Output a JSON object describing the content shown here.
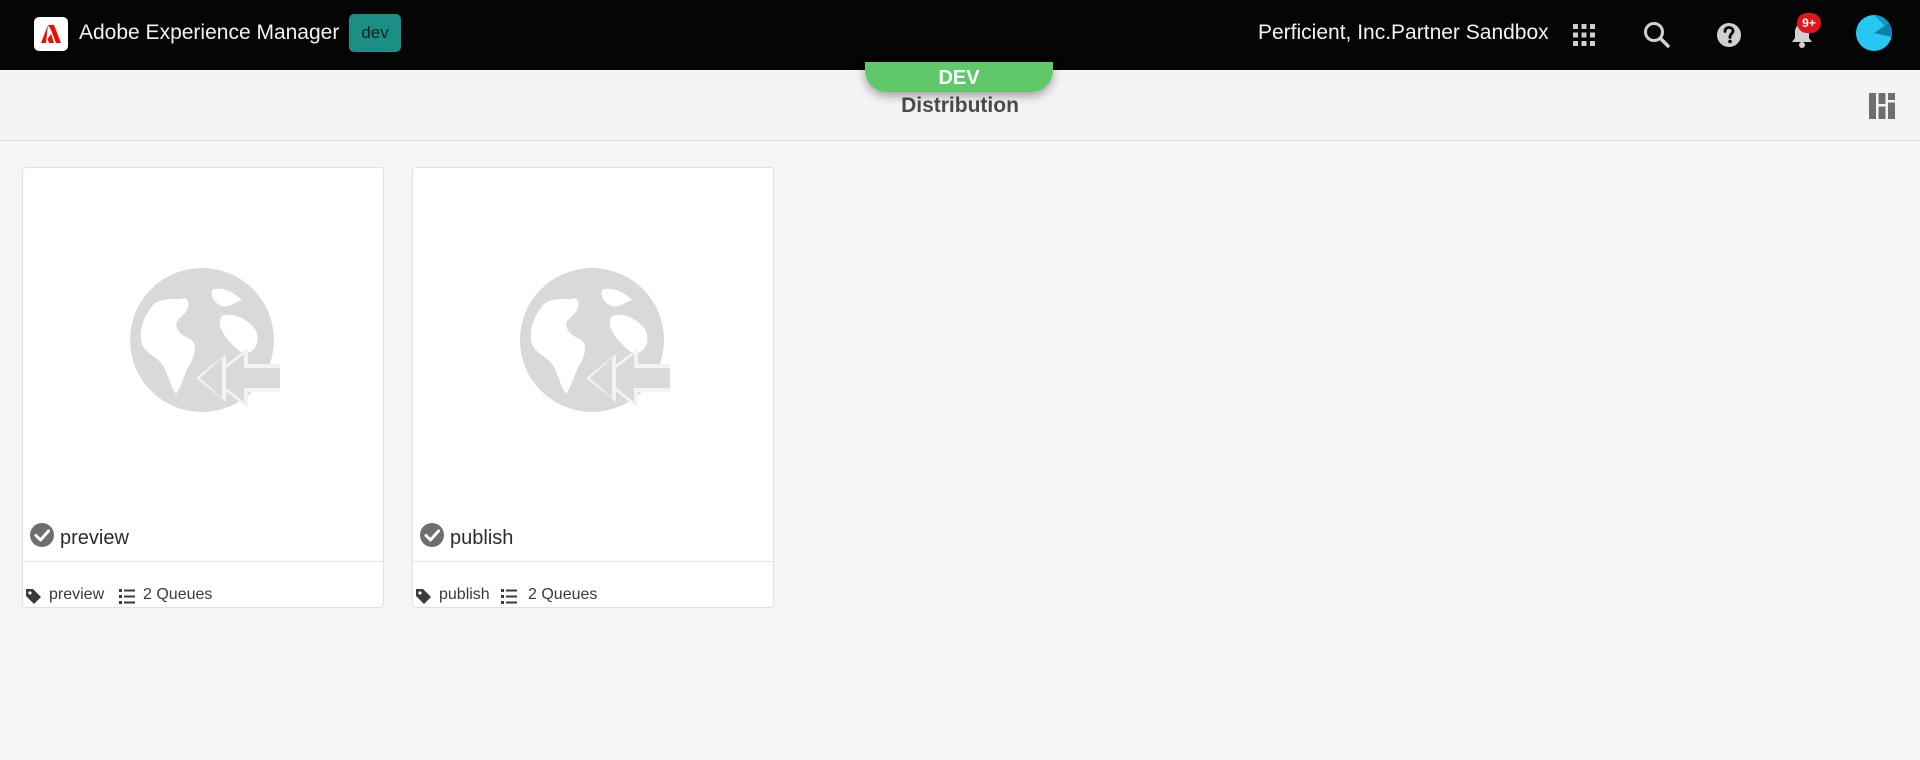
{
  "shell": {
    "app_title": "Adobe Experience Manager",
    "env_badge": "dev",
    "org_name": "Perficient, Inc.Partner Sandbox",
    "notification_count": "9+",
    "icons": [
      "adobe-logo-icon",
      "apps-grid-icon",
      "search-icon",
      "help-icon",
      "bell-icon",
      "avatar"
    ]
  },
  "titlebar": {
    "env_pill": "DEV",
    "title": "Distribution",
    "view_switch_icon": "card-view-icon"
  },
  "cards": [
    {
      "title": "preview",
      "tag": "preview",
      "queues": "2 Queues",
      "status_icon": "check-circle-icon",
      "thumbnail_icon": "globe-arrow-icon"
    },
    {
      "title": "publish",
      "tag": "publish",
      "queues": "2 Queues",
      "status_icon": "check-circle-icon",
      "thumbnail_icon": "globe-arrow-icon"
    }
  ],
  "colors": {
    "shell_bg": "#050505",
    "env_badge": "#1a8f86",
    "dev_pill": "#5fc96a",
    "notification": "#e4151b",
    "page_bg": "#f5f5f5"
  }
}
